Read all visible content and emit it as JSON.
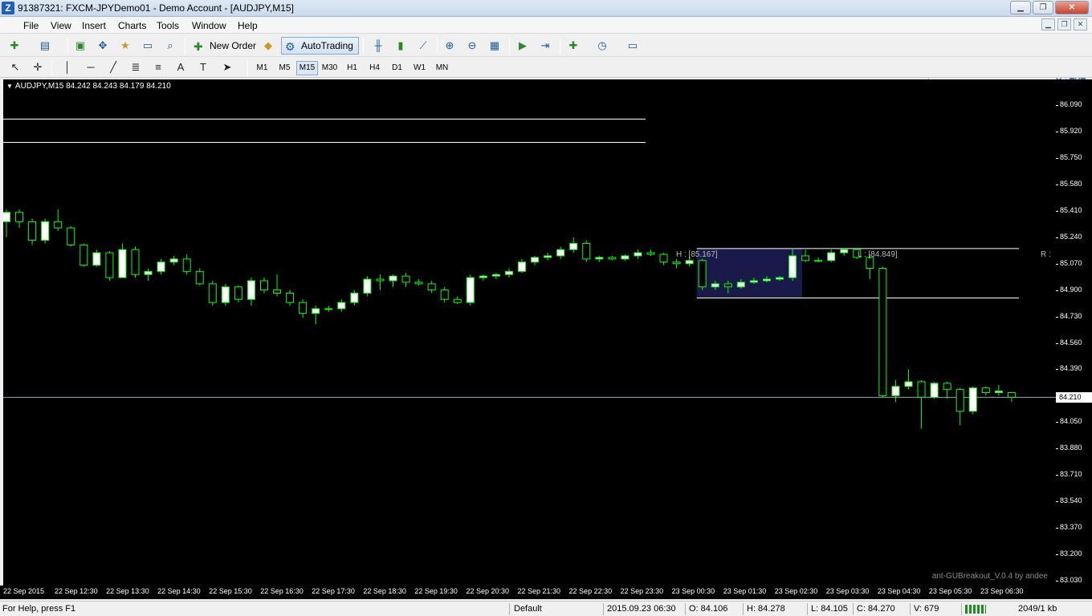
{
  "window": {
    "title": "91387321: FXCM-JPYDemo01 - Demo Account - [AUDJPY,M15]",
    "app_icon": "Z"
  },
  "menu": [
    "File",
    "View",
    "Insert",
    "Charts",
    "Tools",
    "Window",
    "Help"
  ],
  "toolbar": {
    "new_order_label": "New Order",
    "autotrading_label": "AutoTrading"
  },
  "timeframes": [
    "M1",
    "M5",
    "M15",
    "M30",
    "H1",
    "H4",
    "D1",
    "W1",
    "MN"
  ],
  "active_timeframe": "M15",
  "search": {
    "placeholder": ""
  },
  "chart": {
    "label": "AUDJPY,M15  84.242 84.243 84.179 84.210",
    "watermark": "ant-GUBreakout_V.0.4 by andee",
    "high_label": "H : [85.167]",
    "low_label": "L : [84.849]",
    "right_label": "R :",
    "current_price": "84.210",
    "colors": {
      "background": "#000000",
      "bull": "#ffffff",
      "outline": "#00ff00",
      "box": "#1a1a4a"
    }
  },
  "chart_data": {
    "type": "candlestick",
    "symbol": "AUDJPY",
    "timeframe": "M15",
    "y_ticks": [
      "86.090",
      "85.920",
      "85.750",
      "85.580",
      "85.410",
      "85.240",
      "85.070",
      "84.900",
      "84.730",
      "84.560",
      "84.390",
      "84.210",
      "84.050",
      "83.880",
      "83.710",
      "83.540",
      "83.370",
      "83.200",
      "83.030"
    ],
    "x_ticks": [
      "22 Sep 2015",
      "22 Sep 12:30",
      "22 Sep 13:30",
      "22 Sep 14:30",
      "22 Sep 15:30",
      "22 Sep 16:30",
      "22 Sep 17:30",
      "22 Sep 18:30",
      "22 Sep 19:30",
      "22 Sep 20:30",
      "22 Sep 21:30",
      "22 Sep 22:30",
      "22 Sep 23:30",
      "23 Sep 00:30",
      "23 Sep 01:30",
      "23 Sep 02:30",
      "23 Sep 03:30",
      "23 Sep 04:30",
      "23 Sep 05:30",
      "23 Sep 06:30"
    ],
    "ylim": [
      83.0,
      86.2
    ],
    "candles": [
      [
        85.34,
        85.42,
        85.24,
        85.4
      ],
      [
        85.4,
        85.42,
        85.3,
        85.34
      ],
      [
        85.34,
        85.36,
        85.19,
        85.22
      ],
      [
        85.22,
        85.36,
        85.2,
        85.34
      ],
      [
        85.34,
        85.42,
        85.28,
        85.3
      ],
      [
        85.3,
        85.31,
        85.18,
        85.19
      ],
      [
        85.19,
        85.2,
        85.05,
        85.06
      ],
      [
        85.06,
        85.16,
        85.05,
        85.14
      ],
      [
        85.14,
        85.15,
        84.96,
        84.98
      ],
      [
        84.98,
        85.2,
        84.98,
        85.16
      ],
      [
        85.16,
        85.18,
        84.98,
        85.0
      ],
      [
        85.0,
        85.04,
        84.96,
        85.02
      ],
      [
        85.02,
        85.1,
        85.0,
        85.08
      ],
      [
        85.08,
        85.12,
        85.06,
        85.1
      ],
      [
        85.1,
        85.13,
        85.0,
        85.02
      ],
      [
        85.02,
        85.04,
        84.93,
        84.94
      ],
      [
        84.94,
        84.96,
        84.8,
        84.82
      ],
      [
        84.82,
        84.94,
        84.8,
        84.92
      ],
      [
        84.92,
        84.93,
        84.82,
        84.84
      ],
      [
        84.84,
        84.98,
        84.8,
        84.96
      ],
      [
        84.96,
        84.98,
        84.88,
        84.9
      ],
      [
        84.9,
        85.0,
        84.86,
        84.88
      ],
      [
        84.88,
        84.9,
        84.8,
        84.82
      ],
      [
        84.82,
        84.84,
        84.72,
        84.75
      ],
      [
        84.75,
        84.8,
        84.68,
        84.78
      ],
      [
        84.78,
        84.8,
        84.76,
        84.78
      ],
      [
        84.78,
        84.84,
        84.76,
        84.82
      ],
      [
        84.82,
        84.9,
        84.8,
        84.88
      ],
      [
        84.88,
        84.99,
        84.86,
        84.97
      ],
      [
        84.97,
        85.0,
        84.9,
        84.96
      ],
      [
        84.96,
        85.0,
        84.92,
        84.99
      ],
      [
        84.99,
        85.01,
        84.92,
        84.95
      ],
      [
        84.95,
        84.97,
        84.93,
        84.94
      ],
      [
        84.94,
        84.96,
        84.88,
        84.9
      ],
      [
        84.9,
        84.92,
        84.82,
        84.84
      ],
      [
        84.84,
        84.86,
        84.81,
        84.82
      ],
      [
        84.82,
        85.0,
        84.8,
        84.98
      ],
      [
        84.98,
        85.0,
        84.96,
        84.99
      ],
      [
        84.99,
        85.01,
        84.97,
        85.0
      ],
      [
        85.0,
        85.04,
        84.98,
        85.02
      ],
      [
        85.02,
        85.1,
        85.01,
        85.08
      ],
      [
        85.08,
        85.12,
        85.06,
        85.11
      ],
      [
        85.11,
        85.14,
        85.09,
        85.12
      ],
      [
        85.12,
        85.18,
        85.1,
        85.16
      ],
      [
        85.16,
        85.24,
        85.14,
        85.2
      ],
      [
        85.2,
        85.22,
        85.08,
        85.1
      ],
      [
        85.1,
        85.12,
        85.08,
        85.11
      ],
      [
        85.11,
        85.12,
        85.09,
        85.1
      ],
      [
        85.1,
        85.13,
        85.09,
        85.12
      ],
      [
        85.12,
        85.16,
        85.1,
        85.14
      ],
      [
        85.14,
        85.16,
        85.12,
        85.13
      ],
      [
        85.13,
        85.14,
        85.06,
        85.08
      ],
      [
        85.08,
        85.1,
        85.04,
        85.07
      ],
      [
        85.07,
        85.12,
        85.05,
        85.09
      ],
      [
        85.09,
        85.1,
        84.9,
        84.92
      ],
      [
        84.92,
        84.96,
        84.9,
        84.94
      ],
      [
        84.94,
        84.96,
        84.88,
        84.92
      ],
      [
        84.92,
        84.97,
        84.91,
        84.95
      ],
      [
        84.95,
        84.98,
        84.94,
        84.96
      ],
      [
        84.96,
        84.99,
        84.95,
        84.97
      ],
      [
        84.97,
        84.99,
        84.96,
        84.98
      ],
      [
        84.98,
        85.17,
        84.96,
        85.12
      ],
      [
        85.12,
        85.16,
        85.08,
        85.09
      ],
      [
        85.09,
        85.11,
        85.08,
        85.09
      ],
      [
        85.09,
        85.16,
        85.08,
        85.14
      ],
      [
        85.14,
        85.17,
        85.12,
        85.16
      ],
      [
        85.16,
        85.17,
        85.1,
        85.11
      ],
      [
        85.11,
        85.13,
        84.97,
        85.04
      ],
      [
        85.04,
        85.05,
        84.21,
        84.22
      ],
      [
        84.22,
        84.32,
        84.18,
        84.28
      ],
      [
        84.28,
        84.39,
        84.26,
        84.31
      ],
      [
        84.31,
        84.32,
        84.01,
        84.21
      ],
      [
        84.21,
        84.31,
        84.2,
        84.3
      ],
      [
        84.3,
        84.31,
        84.2,
        84.26
      ],
      [
        84.26,
        84.27,
        84.03,
        84.12
      ],
      [
        84.12,
        84.28,
        84.1,
        84.27
      ],
      [
        84.27,
        84.28,
        84.22,
        84.24
      ],
      [
        84.24,
        84.29,
        84.22,
        84.25
      ],
      [
        84.24,
        84.24,
        84.18,
        84.21
      ]
    ],
    "hlines": [
      85.167,
      84.849,
      84.21
    ],
    "top_lines": [
      86.0,
      85.85
    ]
  },
  "status": {
    "help": "For Help, press F1",
    "profile": "Default",
    "datetime": "2015.09.23 06:30",
    "open": "O: 84.106",
    "high": "H: 84.278",
    "low": "L: 84.105",
    "close": "C: 84.270",
    "volume": "V: 679",
    "traffic": "2049/1 kb"
  }
}
